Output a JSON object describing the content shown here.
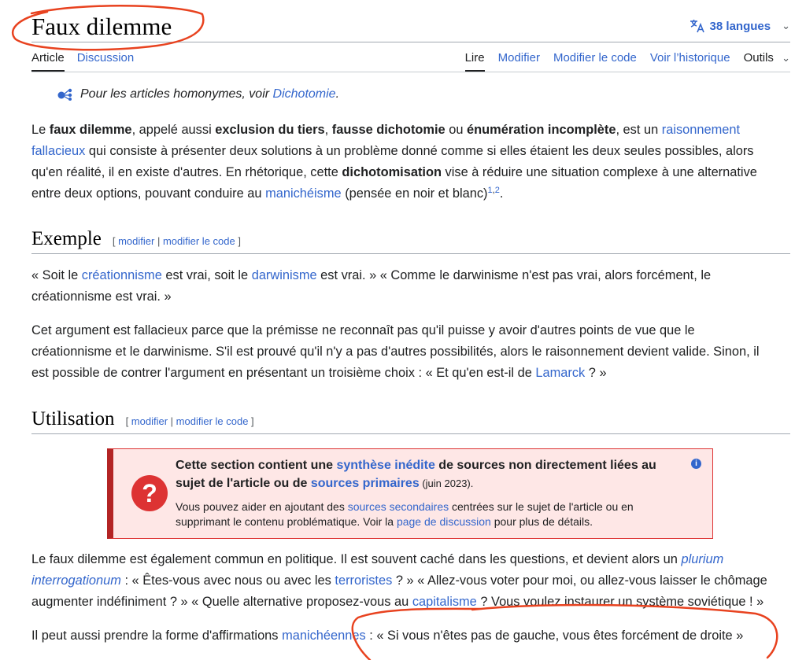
{
  "page": {
    "title": "Faux dilemme",
    "languages": "38 langues",
    "tabs_left": [
      "Article",
      "Discussion"
    ],
    "tabs_right": [
      "Lire",
      "Modifier",
      "Modifier le code",
      "Voir l’historique",
      "Outils"
    ]
  },
  "hatnote": {
    "text": "Pour les articles homonymes, voir ",
    "link": "Dichotomie",
    "end": "."
  },
  "intro": {
    "t1": "Le ",
    "b1": "faux dilemme",
    "t2": ", appelé aussi ",
    "b2": "exclusion du tiers",
    "t3": ", ",
    "b3": "fausse dichotomie",
    "t4": " ou ",
    "b4": "énumération incomplète",
    "t5": ", est un ",
    "l1": "raisonnement fallacieux",
    "t6": " qui consiste à présenter deux solutions à un problème donné comme si elles étaient les deux seules possibles, alors qu'en réalité, il en existe d'autres. En rhétorique, cette ",
    "b5": "dichotomisation",
    "t7": " vise à réduire une situation complexe à une alternative entre deux options, pouvant conduire au ",
    "l2": "manichéisme",
    "t8": " (pensée en noir et blanc)",
    "ref1": "1",
    "refsep": ",",
    "ref2": "2",
    "t9": "."
  },
  "sections": {
    "edit_open": "[ ",
    "edit_modifier": "modifier",
    "edit_sep": " | ",
    "edit_code": "modifier le code",
    "edit_close": " ]",
    "exemple": "Exemple",
    "utilisation": "Utilisation"
  },
  "exemple": {
    "p1_t1": "« Soit le ",
    "p1_l1": "créationnisme",
    "p1_t2": " est vrai, soit le ",
    "p1_l2": "darwinisme",
    "p1_t3": " est vrai. » « Comme le darwinisme n'est pas vrai, alors forcément, le créationnisme est vrai. »",
    "p2_t1": "Cet argument est fallacieux parce que la prémisse ne reconnaît pas qu'il puisse y avoir d'autres points de vue que le créationnisme et le darwinisme. S'il est prouvé qu'il n'y a pas d'autres possibilités, alors le raisonnement devient valide. Sinon, il est possible de contrer l'argument en présentant un troisième choix : « Et qu'en est-il de ",
    "p2_l1": "Lamarck",
    "p2_t2": " ? »"
  },
  "ambox": {
    "t1": "Cette section contient une ",
    "l1": "synthèse inédite",
    "t2": " de sources non directement liées au sujet de l'article ou de ",
    "l2": "sources primaires",
    "date": " (juin 2023).",
    "s1": "Vous pouvez aider en ajoutant des ",
    "sl1": "sources secondaires",
    "s2": " centrées sur le sujet de l'article ou en supprimant le contenu problématique. Voir la ",
    "sl2": "page de discussion",
    "s3": " pour plus de détails.",
    "icon": "?",
    "info": "i"
  },
  "utilisation": {
    "p1_t1": "Le faux dilemme est également commun en politique. Il est souvent caché dans les questions, et devient alors un ",
    "p1_l1": "plurium interrogationum",
    "p1_t2": " : « Êtes-vous avec nous ou avec les ",
    "p1_l2": "terroristes",
    "p1_t3": " ? » « Allez-vous voter pour moi, ou allez-vous laisser le chômage augmenter indéfiniment ? » « Quelle alternative proposez-vous au ",
    "p1_l3": "capitalisme",
    "p1_t4": " ? Vous voulez instaurer un système soviétique ! »",
    "p2_t1": "Il peut aussi prendre la forme d'affirmations ",
    "p2_l1": "manichéennes",
    "p2_t2": " : « Si vous n'êtes pas de gauche, vous êtes forcément de droite »"
  },
  "colors": {
    "link": "#3366cc",
    "annotation": "#e8421f",
    "ambox_bg": "#fee7e6",
    "ambox_border": "#b32424"
  }
}
